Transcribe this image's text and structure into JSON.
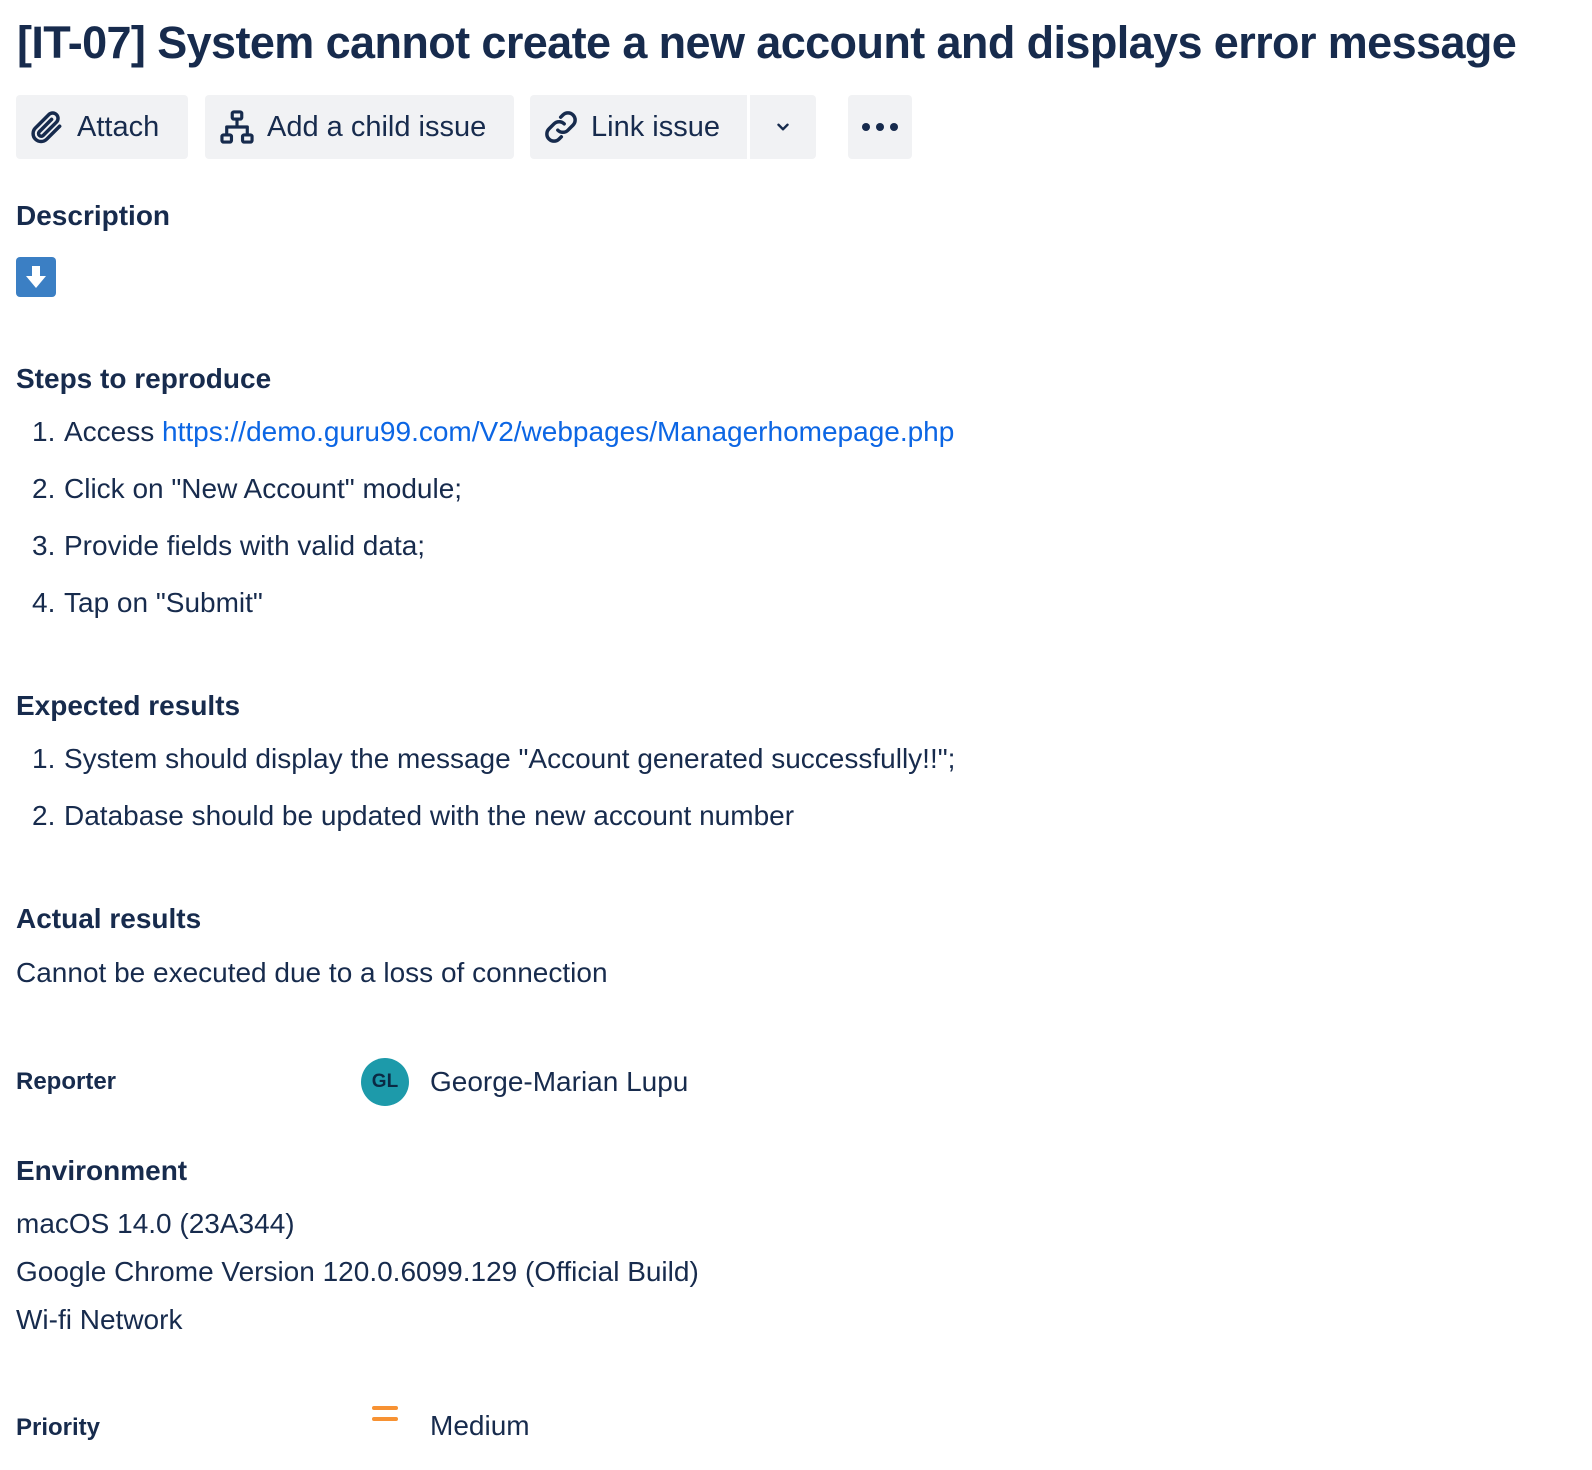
{
  "issue": {
    "title": "[IT-07] System cannot create a new account and displays error message"
  },
  "toolbar": {
    "attach_label": "Attach",
    "add_child_label": "Add a child issue",
    "link_issue_label": "Link issue",
    "icons": [
      "paperclip-icon",
      "hierarchy-icon",
      "link-icon",
      "chevron-down-icon",
      "more-horizontal-icon"
    ]
  },
  "description": {
    "heading": "Description",
    "emoji": "arrow-down-emoji",
    "emoji_color": "#3b7fc4",
    "steps_heading": "Steps to reproduce",
    "steps": [
      {
        "num": "1.",
        "prefix": "Access ",
        "link": "https://demo.guru99.com/V2/webpages/Managerhomepage.php"
      },
      {
        "num": "2.",
        "text": "Click on \"New Account\" module;"
      },
      {
        "num": "3.",
        "text": "Provide fields with valid data;"
      },
      {
        "num": "4.",
        "text": "Tap on \"Submit\""
      }
    ],
    "expected_heading": "Expected results",
    "expected": [
      {
        "num": "1.",
        "text": "System should display the message \"Account generated successfully!!\";"
      },
      {
        "num": "2.",
        "text": "Database should be updated with the new account number"
      }
    ],
    "actual_heading": "Actual results",
    "actual_text": "Cannot be executed due to a loss of connection"
  },
  "fields": {
    "reporter_label": "Reporter",
    "reporter_initials": "GL",
    "reporter_name": "George-Marian Lupu",
    "avatar_color": "#1d9aaa",
    "environment_heading": "Environment",
    "environment_lines": [
      "macOS 14.0 (23A344)",
      "Google Chrome Version 120.0.6099.129 (Official Build)",
      "Wi-fi Network"
    ],
    "priority_label": "Priority",
    "priority_value": "Medium",
    "priority_color": "#f79233"
  },
  "colors": {
    "text": "#172b4d",
    "link": "#0c66e4",
    "button_bg": "#f1f2f4"
  }
}
